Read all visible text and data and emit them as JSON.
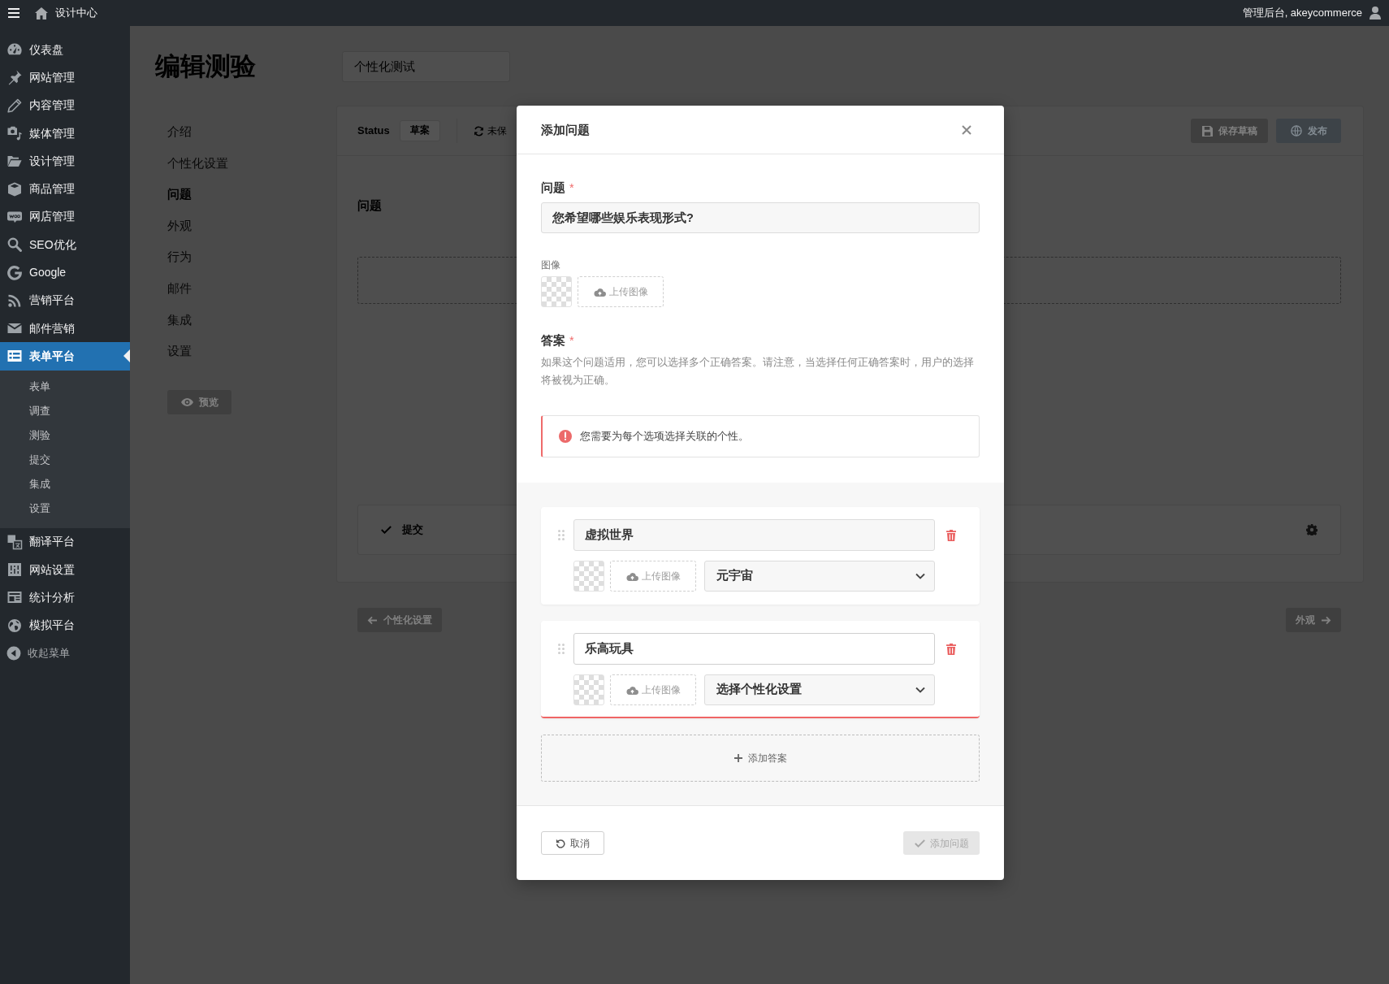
{
  "top_bar": {
    "site_title": "设计中心",
    "user_greeting": "管理后台, akeycommerce"
  },
  "sidebar": {
    "items": [
      {
        "label": "仪表盘",
        "selected": false
      },
      {
        "label": "网站管理",
        "selected": false
      },
      {
        "label": "内容管理",
        "selected": false
      },
      {
        "label": "媒体管理",
        "selected": false
      },
      {
        "label": "设计管理",
        "selected": false
      },
      {
        "label": "商品管理",
        "selected": false
      },
      {
        "label": "网店管理",
        "selected": false
      },
      {
        "label": "SEO优化",
        "selected": false
      },
      {
        "label": "Google",
        "selected": false
      },
      {
        "label": "营销平台",
        "selected": false
      },
      {
        "label": "邮件营销",
        "selected": false
      },
      {
        "label": "表单平台",
        "selected": true,
        "children": [
          {
            "label": "表单",
            "selected": false
          },
          {
            "label": "调查",
            "selected": false
          },
          {
            "label": "测验",
            "selected": false
          },
          {
            "label": "提交",
            "selected": false
          },
          {
            "label": "集成",
            "selected": false
          },
          {
            "label": "设置",
            "selected": false
          }
        ]
      },
      {
        "label": "翻译平台",
        "selected": false
      },
      {
        "label": "网站设置",
        "selected": false
      },
      {
        "label": "统计分析",
        "selected": false
      },
      {
        "label": "模拟平台",
        "selected": false
      }
    ],
    "collapse_label": "收起菜单"
  },
  "editor": {
    "title": "编辑测验",
    "name_field": {
      "value": "个性化测试"
    },
    "steps": [
      {
        "label": "介绍",
        "selected": false
      },
      {
        "label": "个性化设置",
        "selected": false
      },
      {
        "label": "问题",
        "selected": true
      },
      {
        "label": "外观",
        "selected": false
      },
      {
        "label": "行为",
        "selected": false
      },
      {
        "label": "邮件",
        "selected": false
      },
      {
        "label": "集成",
        "selected": false
      },
      {
        "label": "设置",
        "selected": false
      }
    ],
    "preview_button": "预览",
    "status": {
      "label": "Status",
      "badge": "草案",
      "save_state": "未保"
    },
    "save_draft_button": "保存草稿",
    "publish_button": "发布",
    "section_title": "问题",
    "submit_step": "提交",
    "prev_button": "个性化设置",
    "next_button": "外观"
  },
  "modal": {
    "title": "添加问题",
    "question": {
      "label": "问题",
      "required_mark": "*",
      "value": "您希望哪些娱乐表现形式?"
    },
    "image": {
      "label": "图像",
      "upload_button": "上传图像"
    },
    "answers_field": {
      "label": "答案",
      "required_mark": "*",
      "help": "如果这个问题适用，您可以选择多个正确答案。请注意，当选择任何正确答案时，用户的选择将被视为正确。",
      "alert": "您需要为每个选项选择关联的个性。"
    },
    "answers": [
      {
        "value": "虚拟世界",
        "upload_button": "上传图像",
        "personality": "元宇宙",
        "focused": false,
        "invalid": false
      },
      {
        "value": "乐高玩具",
        "upload_button": "上传图像",
        "personality": "选择个性化设置",
        "focused": true,
        "invalid": true
      }
    ],
    "add_answer_button": "添加答案",
    "cancel_button": "取消",
    "submit_button": {
      "label": "添加问题",
      "disabled": true
    }
  }
}
